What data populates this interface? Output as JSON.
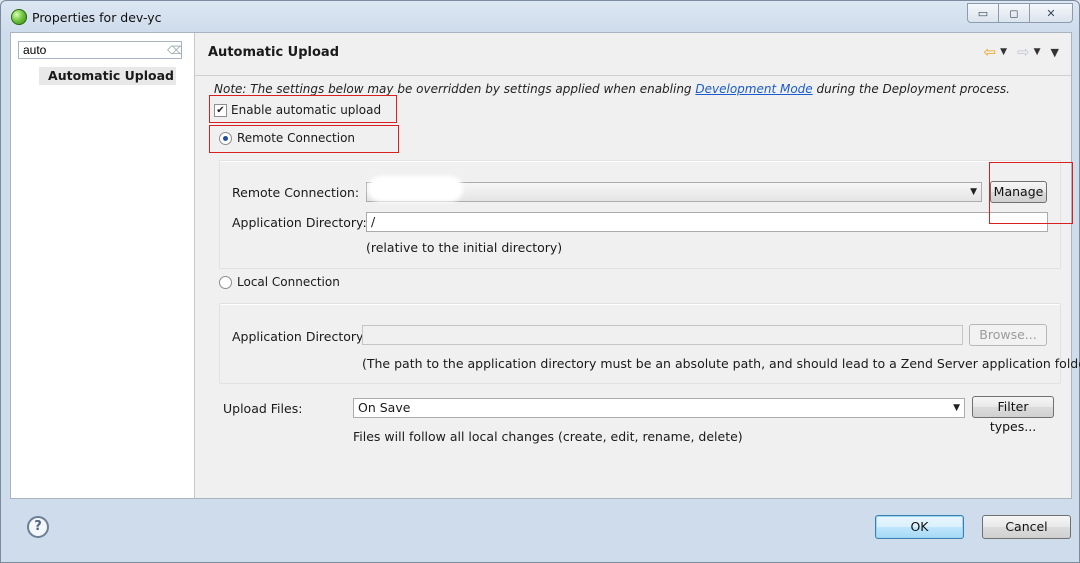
{
  "window": {
    "title": "Properties for dev-yc",
    "controls": {
      "minimize": "▭",
      "maximize": "◻",
      "close": "✕"
    }
  },
  "sidebar": {
    "filter_value": "auto",
    "items": [
      {
        "label": "Automatic Upload"
      }
    ]
  },
  "page": {
    "title": "Automatic Upload",
    "note_prefix": "Note: The settings below may be overridden by settings applied when enabling ",
    "note_link": "Development Mode",
    "note_suffix": " during the Deployment process.",
    "enable_upload_label": "Enable automatic upload",
    "enable_upload_checked": true,
    "remote": {
      "radio_label": "Remote Connection",
      "selected": true,
      "connection_label": "Remote Connection:",
      "connection_value": "",
      "manage_label": "Manage",
      "app_dir_label": "Application Directory:",
      "app_dir_value": "/",
      "app_dir_hint": "(relative to the initial directory)"
    },
    "local": {
      "radio_label": "Local Connection",
      "selected": false,
      "app_dir_label": "Application Directory:",
      "app_dir_value": "",
      "browse_label": "Browse...",
      "app_dir_hint": "(The path to the application directory must be an absolute path, and should lead to a Zend Server application folder.)"
    },
    "upload": {
      "label": "Upload Files:",
      "value": "On Save",
      "filter_label": "Filter types...",
      "hint": "Files will follow all local changes (create, edit, rename, delete)"
    }
  },
  "footer": {
    "help": "?",
    "ok_label": "OK",
    "cancel_label": "Cancel"
  },
  "icons": {
    "app": "eclipse-icon",
    "back": "back-arrow-icon",
    "forward": "forward-arrow-icon",
    "menu": "view-menu-icon",
    "help": "help-icon"
  }
}
